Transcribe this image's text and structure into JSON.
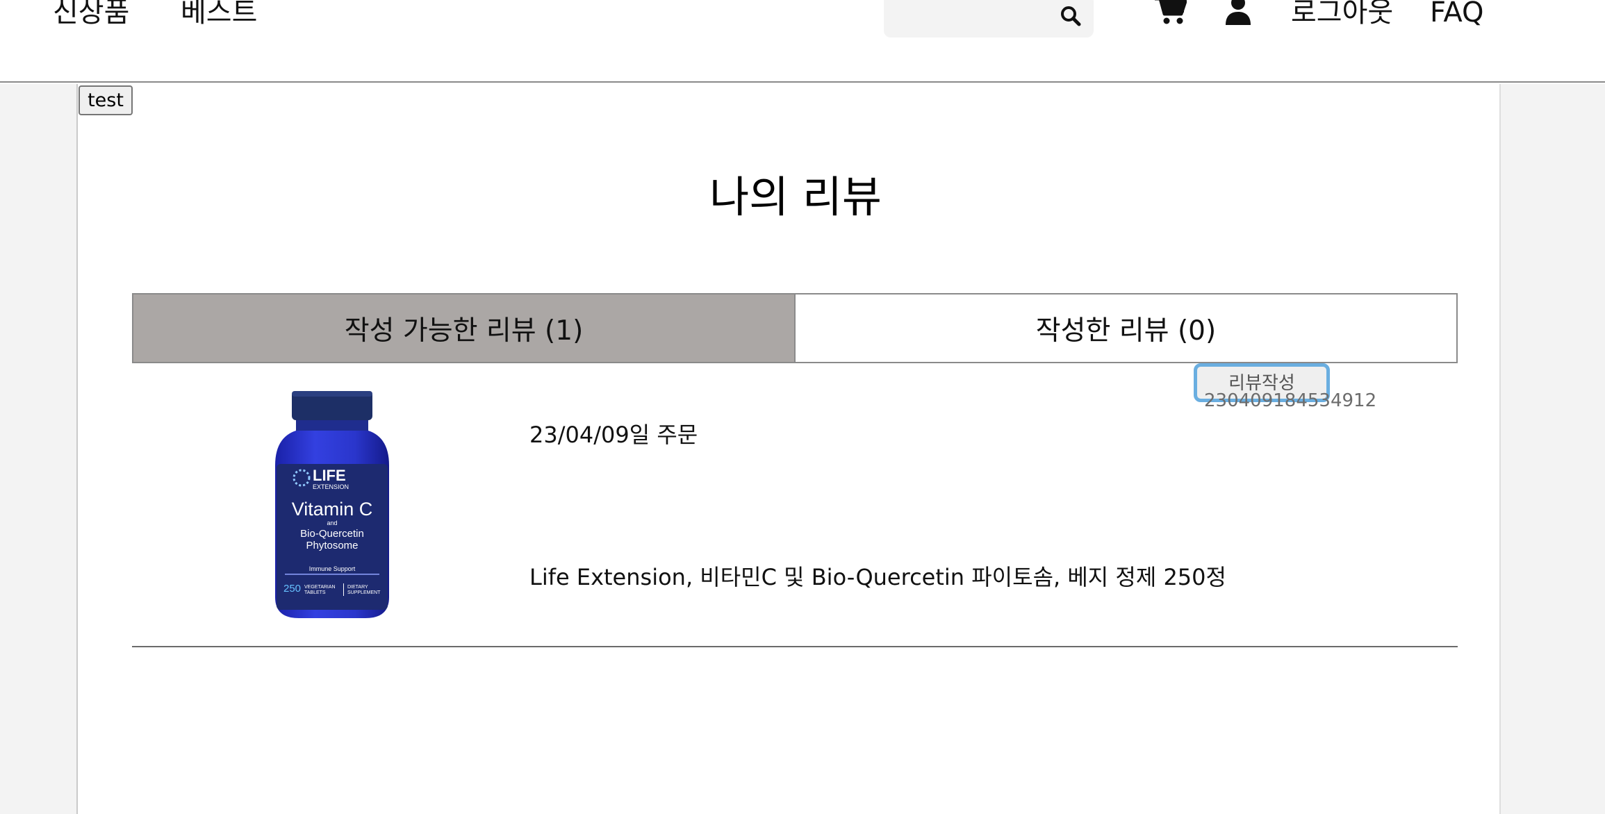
{
  "header": {
    "nav": {
      "new_products": "신상품",
      "best": "베스트"
    },
    "search": {
      "value": "",
      "placeholder": ""
    },
    "logout": "로그아웃",
    "faq": "FAQ",
    "icons": {
      "search": "search-icon",
      "cart": "cart-icon",
      "user": "user-icon"
    }
  },
  "test_button": "test",
  "page_title": "나의 리뷰",
  "tabs": [
    {
      "label": "작성 가능한 리뷰 (1)",
      "active": true
    },
    {
      "label": "작성한 리뷰 (0)",
      "active": false
    }
  ],
  "reviews": [
    {
      "order_date": "23/04/09일 주문",
      "product_name": "Life Extension, 비타민C 및 Bio-Quercetin 파이토솜, 베지 정제 250정",
      "write_review_label": "리뷰작성",
      "order_number": "230409184534912",
      "image": {
        "brand": "LIFE",
        "brand_sub": "EXTENSION",
        "title": "Vitamin C",
        "and": "and",
        "subtitle_1": "Bio-Quercetin",
        "subtitle_2": "Phytosome",
        "tag": "Immune Support",
        "count": "250",
        "count_label_1": "VEGETARIAN",
        "count_label_2": "TABLETS",
        "supp_1": "DIETARY",
        "supp_2": "SUPPLEMENT"
      }
    }
  ],
  "colors": {
    "active_tab_bg": "#aba7a5",
    "focus_ring": "#6aaee0",
    "sidebar_bg": "#f3f3f3",
    "bottle_blue": "#2f3bd0",
    "cap_navy": "#1d2f66"
  }
}
